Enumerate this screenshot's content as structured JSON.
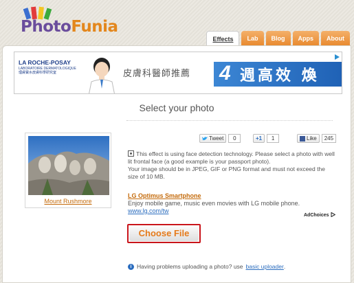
{
  "logo": {
    "part1": "Photo",
    "part2": "Funia"
  },
  "nav": {
    "tabs": [
      "Effects",
      "Lab",
      "Blog",
      "Apps",
      "About"
    ]
  },
  "ad_banner": {
    "brand": "LA ROCHE-POSAY",
    "brand_sub": "LABORATOIRE DERMATOLOGIQUE 理膚寶水皮膚科學研究室",
    "headline": "皮膚科醫師推薦",
    "number": "4",
    "headline2": "週高效 煥"
  },
  "page": {
    "title": "Select your photo"
  },
  "photo": {
    "caption": "Mount Rushmore"
  },
  "social": {
    "tweet_label": "Tweet",
    "tweet_count": "0",
    "gplus_label": "+1",
    "gplus_count": "1",
    "like_label": "Like",
    "like_count": "245"
  },
  "info": {
    "line1": "This effect is using face detection technology. Please select a photo with well lit frontal face (a good example is your passport photo).",
    "line2": "Your image should be in JPEG, GIF or PNG format and must not exceed the size of 10 MB."
  },
  "ad_link": {
    "heading": "LG Optimus Smartphone",
    "desc": "Enjoy mobile game, music even movies with LG mobile phone.",
    "url": "www.lg.com/tw"
  },
  "adchoices": "AdChoices",
  "choose_file": "Choose File",
  "problem": {
    "text": "Having problems uploading a photo? use",
    "link": "basic uploader",
    "end": "."
  }
}
